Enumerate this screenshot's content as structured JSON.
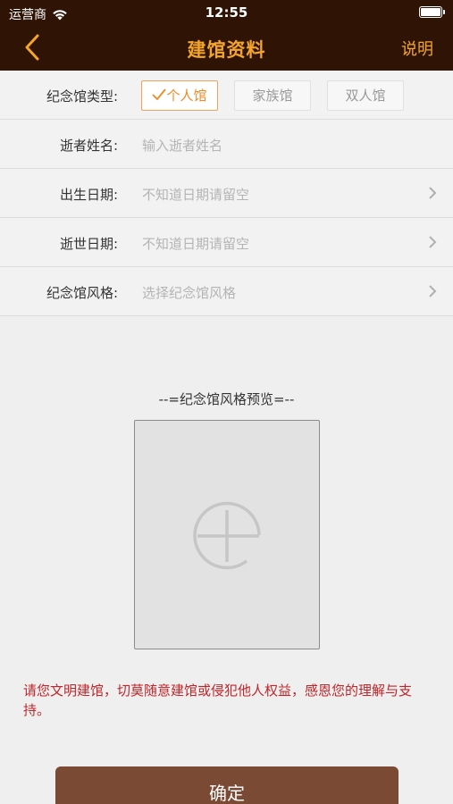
{
  "status_bar": {
    "carrier": "运营商",
    "time": "12:55"
  },
  "nav": {
    "title": "建馆资料",
    "help_label": "说明"
  },
  "form": {
    "type": {
      "label": "纪念馆类型:",
      "options": [
        {
          "label": "个人馆",
          "selected": true
        },
        {
          "label": "家族馆",
          "selected": false
        },
        {
          "label": "双人馆",
          "selected": false
        }
      ]
    },
    "name": {
      "label": "逝者姓名:",
      "placeholder": "输入逝者姓名"
    },
    "birth_date": {
      "label": "出生日期:",
      "placeholder": "不知道日期请留空"
    },
    "death_date": {
      "label": "逝世日期:",
      "placeholder": "不知道日期请留空"
    },
    "style": {
      "label": "纪念馆风格:",
      "placeholder": "选择纪念馆风格"
    }
  },
  "preview": {
    "title": "--=纪念馆风格预览=--",
    "icon": "add-circle-icon"
  },
  "notice": "请您文明建馆，切莫随意建馆或侵犯他人权益，感恩您的理解与支持。",
  "confirm_label": "确定",
  "colors": {
    "header_bg": "#2f1406",
    "accent": "#f3a52c",
    "selected_option": "#f08a24",
    "notice": "#c0252a",
    "confirm_bg": "#7a4a34"
  }
}
